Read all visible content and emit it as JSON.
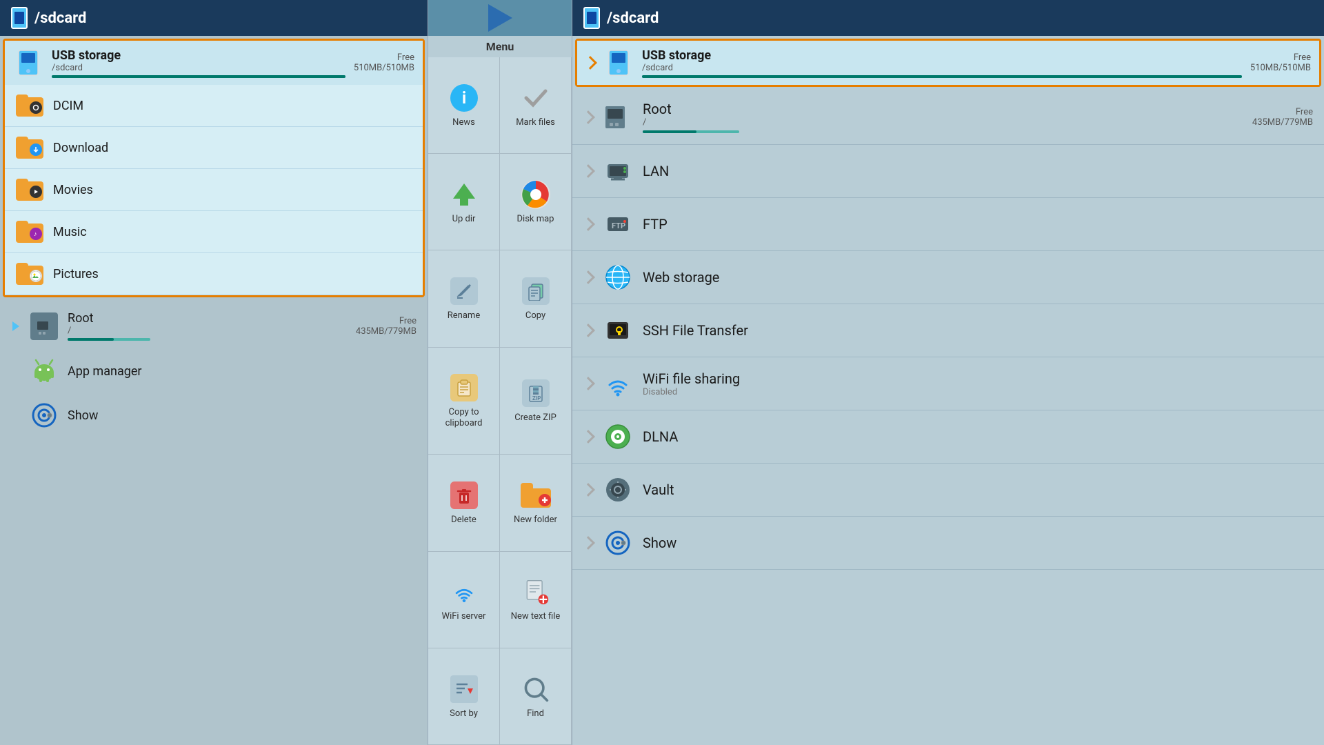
{
  "left": {
    "header": {
      "title": "/sdcard"
    },
    "usb_storage": {
      "name": "USB storage",
      "path": "/sdcard",
      "free_label": "Free",
      "size": "510MB/510MB",
      "progress_pct": 100
    },
    "files": [
      {
        "name": "DCIM",
        "badge": "camera"
      },
      {
        "name": "Download",
        "badge": "download"
      },
      {
        "name": "Movies",
        "badge": "movie"
      },
      {
        "name": "Music",
        "badge": "music"
      },
      {
        "name": "Pictures",
        "badge": "pictures"
      }
    ],
    "bottom_items": [
      {
        "name": "Root",
        "path": "/",
        "free_label": "Free",
        "size": "435MB/779MB",
        "type": "root"
      },
      {
        "name": "App manager",
        "type": "android"
      },
      {
        "name": "Show",
        "type": "show"
      }
    ]
  },
  "middle": {
    "menu_label": "Menu",
    "items": [
      {
        "id": "news",
        "label": "News"
      },
      {
        "id": "mark_files",
        "label": "Mark files"
      },
      {
        "id": "up_dir",
        "label": "Up dir"
      },
      {
        "id": "disk_map",
        "label": "Disk map"
      },
      {
        "id": "rename",
        "label": "Rename"
      },
      {
        "id": "copy",
        "label": "Copy"
      },
      {
        "id": "copy_clipboard",
        "label": "Copy to clipboard"
      },
      {
        "id": "create_zip",
        "label": "Create ZIP"
      },
      {
        "id": "delete",
        "label": "Delete"
      },
      {
        "id": "new_folder",
        "label": "New folder"
      },
      {
        "id": "wifi_server",
        "label": "WiFi server"
      },
      {
        "id": "new_text_file",
        "label": "New text file"
      },
      {
        "id": "sort_by",
        "label": "Sort by"
      },
      {
        "id": "find",
        "label": "Find"
      }
    ]
  },
  "right": {
    "header": {
      "title": "/sdcard"
    },
    "usb_storage": {
      "name": "USB storage",
      "path": "/sdcard",
      "free_label": "Free",
      "size": "510MB/510MB"
    },
    "items": [
      {
        "name": "Root",
        "path": "/",
        "free_label": "Free",
        "size": "435MB/779MB",
        "type": "root",
        "has_progress": true
      },
      {
        "name": "LAN",
        "type": "lan"
      },
      {
        "name": "FTP",
        "type": "ftp"
      },
      {
        "name": "Web storage",
        "type": "web"
      },
      {
        "name": "SSH File Transfer",
        "type": "ssh"
      },
      {
        "name": "WiFi file sharing",
        "sub": "Disabled",
        "type": "wifi"
      },
      {
        "name": "DLNA",
        "type": "dlna"
      },
      {
        "name": "Vault",
        "type": "vault"
      },
      {
        "name": "Show",
        "type": "show"
      }
    ]
  }
}
